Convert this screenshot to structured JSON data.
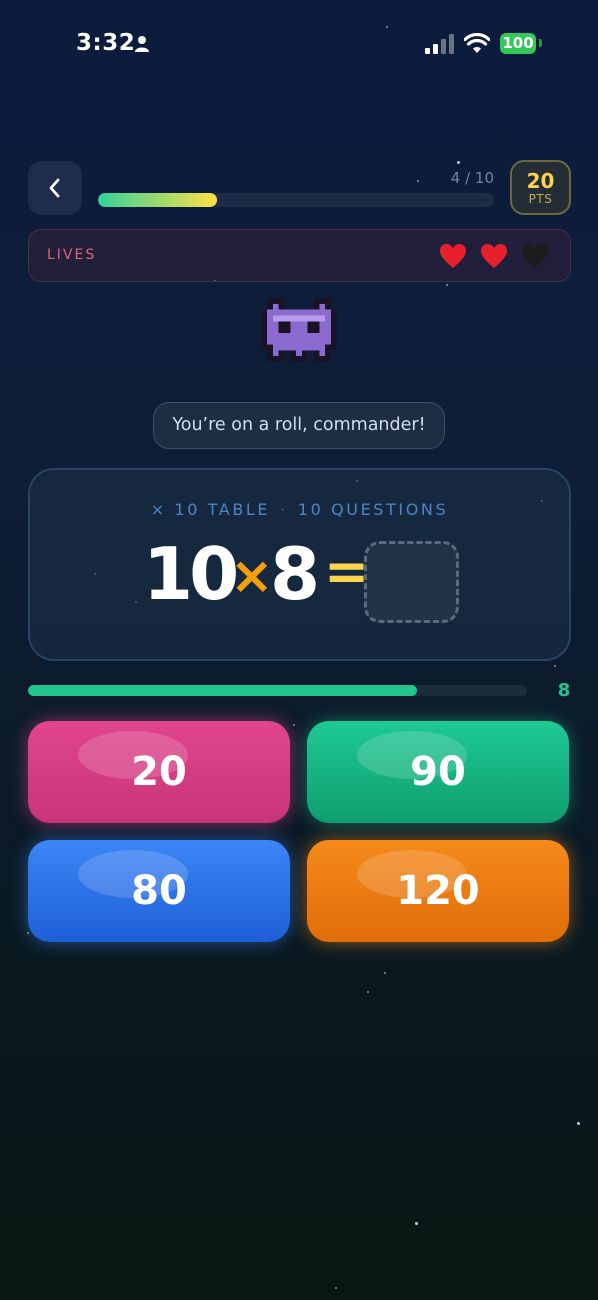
{
  "status_bar": {
    "time": "3:32",
    "battery": "100"
  },
  "header": {
    "progress_label": "4 / 10",
    "progress_fraction": 0.3,
    "points_value": "20",
    "points_unit": "PTS"
  },
  "lives": {
    "label": "LIVES",
    "total": 3,
    "remaining": 2
  },
  "message": "You’re on a roll, commander!",
  "question": {
    "table_label": "× 10 TABLE",
    "separator": "·",
    "count_label": "10 QUESTIONS",
    "left_operand": "10",
    "operator": "×",
    "right_operand": "8",
    "equals": "="
  },
  "timer": {
    "value": "8",
    "fraction": 0.78
  },
  "answers": [
    "20",
    "90",
    "80",
    "120"
  ],
  "colors": {
    "pink": "#e0468e",
    "green": "#1ec993",
    "blue": "#3b86f6",
    "orange": "#f58a1a",
    "gold": "#fcd34d",
    "timer": "#22c58e"
  },
  "icons": [
    "person-icon",
    "signal-icon",
    "wifi-icon",
    "chevron-left-icon",
    "heart-icon",
    "alien-icon"
  ]
}
